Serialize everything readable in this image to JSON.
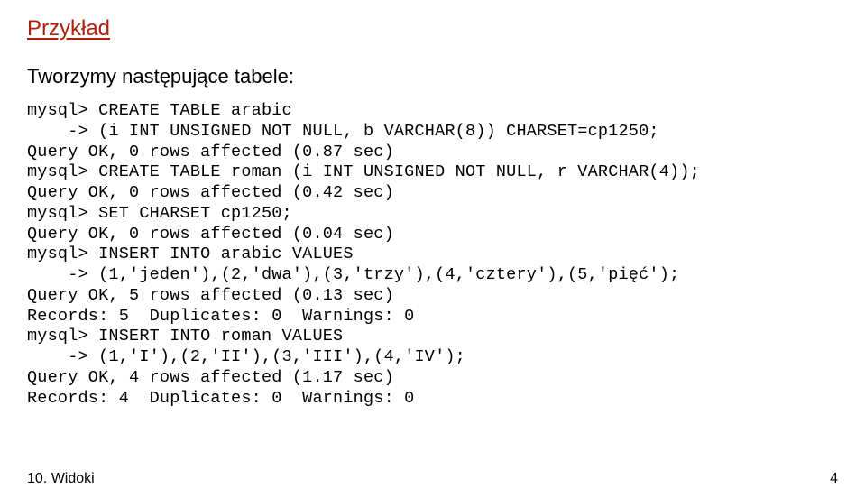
{
  "heading": "Przykład",
  "intro": "Tworzymy następujące tabele:",
  "code_lines": [
    "mysql> CREATE TABLE arabic",
    "    -> (i INT UNSIGNED NOT NULL, b VARCHAR(8)) CHARSET=cp1250;",
    "Query OK, 0 rows affected (0.87 sec)",
    "mysql> CREATE TABLE roman (i INT UNSIGNED NOT NULL, r VARCHAR(4));",
    "Query OK, 0 rows affected (0.42 sec)",
    "mysql> SET CHARSET cp1250;",
    "Query OK, 0 rows affected (0.04 sec)",
    "mysql> INSERT INTO arabic VALUES",
    "    -> (1,'jeden'),(2,'dwa'),(3,'trzy'),(4,'cztery'),(5,'pięć');",
    "Query OK, 5 rows affected (0.13 sec)",
    "Records: 5  Duplicates: 0  Warnings: 0",
    "mysql> INSERT INTO roman VALUES",
    "    -> (1,'I'),(2,'II'),(3,'III'),(4,'IV');",
    "Query OK, 4 rows affected (1.17 sec)",
    "Records: 4  Duplicates: 0  Warnings: 0"
  ],
  "footer": {
    "left": "10. Widoki",
    "right": "4"
  }
}
